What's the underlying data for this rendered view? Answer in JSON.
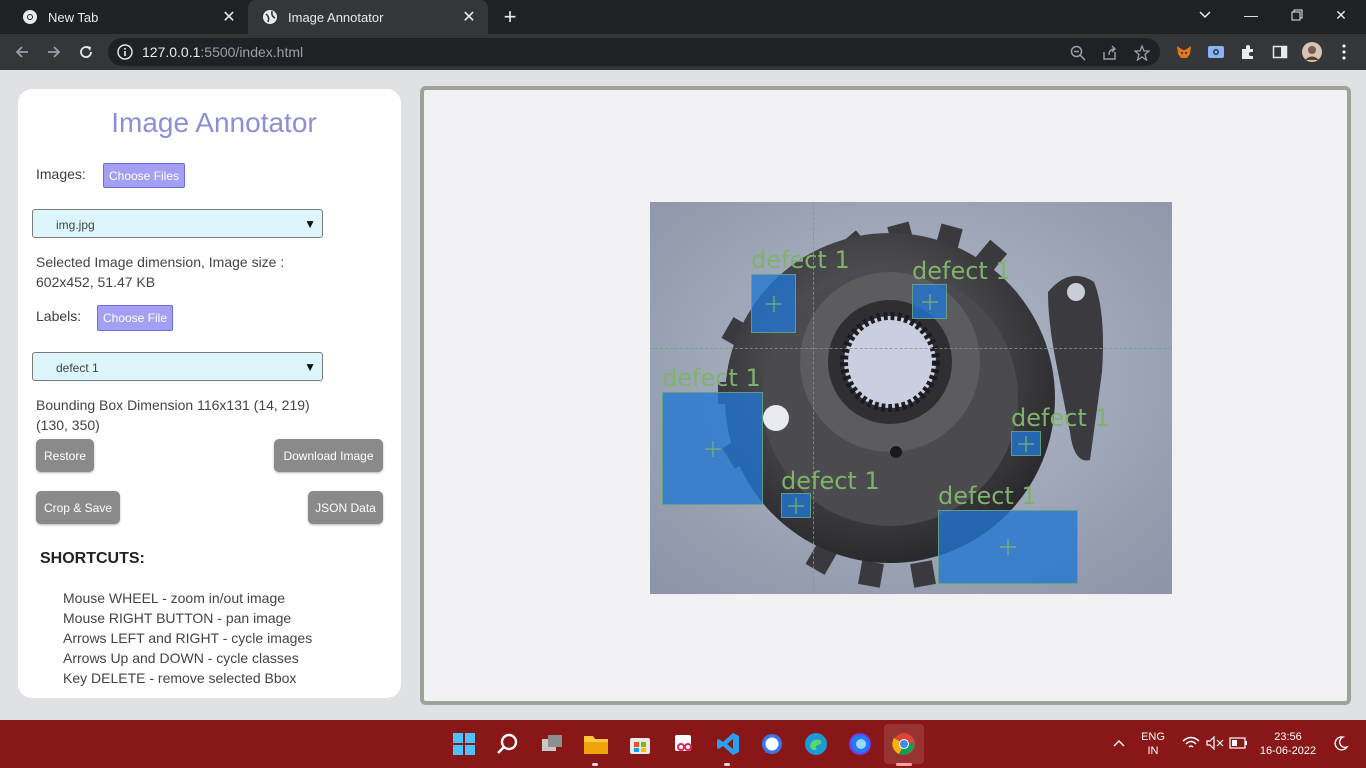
{
  "browser": {
    "tabs": [
      {
        "title": "New Tab",
        "active": false
      },
      {
        "title": "Image Annotator",
        "active": true
      }
    ],
    "url_host": "127.0.0.1",
    "url_rest": ":5500/index.html"
  },
  "sidebar": {
    "title": "Image Annotator",
    "images_label": "Images:",
    "choose_files_label": "Choose Files",
    "image_select_value": "img.jpg",
    "dimension_line1": "Selected Image dimension, Image size :",
    "dimension_line2": "602x452, 51.47 KB",
    "labels_label": "Labels:",
    "choose_file_label": "Choose File",
    "label_select_value": "defect 1",
    "bbox_line1": "Bounding Box Dimension 116x131 (14, 219)",
    "bbox_line2": "(130, 350)",
    "restore_label": "Restore",
    "download_label": "Download Image",
    "crop_label": "Crop & Save",
    "json_label": "JSON Data",
    "shortcuts_title": "SHORTCUTS:",
    "shortcuts": [
      "Mouse WHEEL - zoom in/out image",
      "Mouse RIGHT BUTTON - pan image",
      "Arrows LEFT and RIGHT - cycle images",
      "Arrows Up and DOWN - cycle classes",
      "Key DELETE - remove selected Bbox"
    ]
  },
  "annotations": [
    {
      "label": "defect 1"
    },
    {
      "label": "defect 1"
    },
    {
      "label": "defect 1"
    },
    {
      "label": "defect 1"
    },
    {
      "label": "defect 1"
    },
    {
      "label": "defect 1"
    }
  ],
  "colors": {
    "accent": "#a3a0f3",
    "title": "#8d8fd6",
    "bbox_fill": "#2176d2",
    "bbox_label": "#7fb36a",
    "taskbar": "#8a1717"
  },
  "taskbar": {
    "lang_line1": "ENG",
    "lang_line2": "IN",
    "time": "23:56",
    "date": "16-06-2022"
  }
}
